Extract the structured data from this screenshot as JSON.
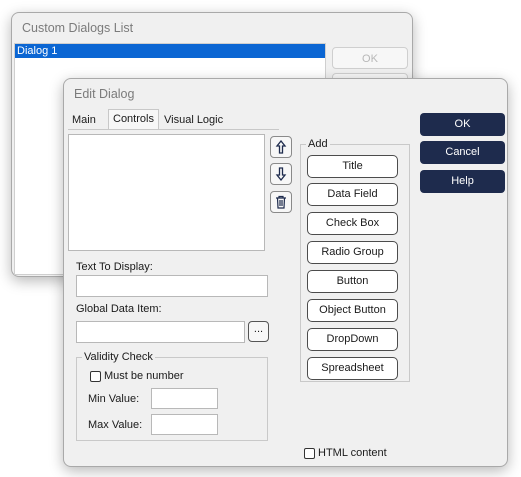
{
  "background_dialog": {
    "title": "Custom Dialogs List",
    "list_items": [
      "Dialog 1"
    ],
    "ok_label": "OK"
  },
  "edit_dialog": {
    "title": "Edit Dialog",
    "tabs": [
      {
        "label": "Main"
      },
      {
        "label": "Controls",
        "selected": true
      },
      {
        "label": "Visual Logic"
      }
    ],
    "text_to_display": {
      "label": "Text To Display:",
      "value": ""
    },
    "global_data_item": {
      "label": "Global Data Item:",
      "value": "",
      "browse_label": "..."
    },
    "validity": {
      "title": "Validity Check",
      "must_be_number_label": "Must be number",
      "must_be_number": false,
      "min_label": "Min Value:",
      "min_value": "",
      "max_label": "Max Value:",
      "max_value": ""
    },
    "add_group": {
      "title": "Add",
      "buttons": [
        "Title",
        "Data Field",
        "Check Box",
        "Radio Group",
        "Button",
        "Object Button",
        "DropDown",
        "Spreadsheet"
      ]
    },
    "html_content_label": "HTML content",
    "html_content": false,
    "side_buttons": {
      "ok": "OK",
      "cancel": "Cancel",
      "help": "Help"
    },
    "accent_color": "#1e2b4d"
  }
}
